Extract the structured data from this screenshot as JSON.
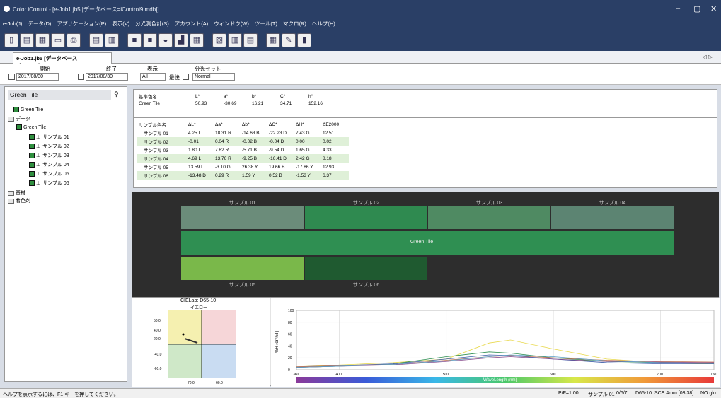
{
  "window": {
    "title": "Color iControl - [e-Job1.jb5 [データベース=iControl9.mdb]]",
    "controls": [
      "–",
      "▢",
      "✕"
    ]
  },
  "menu": [
    "e-Job(J)",
    "データ(D)",
    "アプリケーション(P)",
    "表示(V)",
    "分光測色計(S)",
    "アカウント(A)",
    "ウィンドウ(W)",
    "ツール(T)",
    "マクロ(R)",
    "ヘルプ(H)"
  ],
  "toolbar_icons": [
    "new-doc-icon",
    "open-doc-icon",
    "copy-doc-icon",
    "print-preview-icon",
    "print-icon",
    "report-icon",
    "list-icon",
    "measure-icon",
    "measure2-icon",
    "calibrate-icon",
    "average-icon",
    "doc-a-icon",
    "doc-b-icon",
    "doc-c-icon",
    "doc-d-icon",
    "grid-icon",
    "tool-icon",
    "chart-icon"
  ],
  "tab": {
    "label": "e-Job1.jb5 [データベース=iControl9....",
    "nav": "◁ ▷"
  },
  "filter": {
    "start_label": "開始",
    "end_label": "終了",
    "start_date": "2017/08/30",
    "end_date": "2017/08/30",
    "show_label": "表示",
    "show_value": "All",
    "latest_label": "最後",
    "preset_label": "分光セット",
    "preset_value": "Normal"
  },
  "tree": {
    "header": "Green Tile",
    "root": "Green Tile",
    "data": "データ",
    "group": "Green Tile",
    "samples": [
      "サンプル 01",
      "サンプル 02",
      "サンプル 03",
      "サンプル 04",
      "サンプル 05",
      "サンプル 06"
    ],
    "substrate": "基材",
    "colorant": "着色剤"
  },
  "reference": {
    "headers": [
      "基準色名",
      "L*",
      "a*",
      "b*",
      "C*",
      "h°"
    ],
    "row": [
      "Green Tile",
      "50.93",
      "-30.69",
      "16.21",
      "34.71",
      "152.16"
    ]
  },
  "difference": {
    "headers": [
      "サンプル色名",
      "ΔL*",
      "Δa*",
      "Δb*",
      "ΔC*",
      "ΔH*",
      "ΔE2000"
    ],
    "rows": [
      [
        "サンプル 01",
        "4.25 L",
        "18.31 R",
        "-14.63 B",
        "-22.23 D",
        "7.43 G",
        "12.51"
      ],
      [
        "サンプル 02",
        "-0.01",
        "0.04 R",
        "-0.02 B",
        "-0.04 D",
        "0.00",
        "0.02"
      ],
      [
        "サンプル 03",
        "1.80 L",
        "7.82 R",
        "-5.71 B",
        "-9.54 D",
        "1.65 G",
        "4.33"
      ],
      [
        "サンプル 04",
        "4.69 L",
        "13.76 R",
        "-9.25 B",
        "-16.41 D",
        "2.42 G",
        "8.18"
      ],
      [
        "サンプル 05",
        "13.59 L",
        "-3.10 G",
        "26.38 Y",
        "19.66 B",
        "-17.86 Y",
        "12.93"
      ],
      [
        "サンプル 06",
        "-13.48 D",
        "0.29 R",
        "1.59 Y",
        "0.52 B",
        "-1.53 Y",
        "6.37"
      ]
    ]
  },
  "swatches": {
    "labels": [
      "サンプル 01",
      "サンプル 02",
      "サンプル 03",
      "サンプル 04",
      "Green Tile",
      "サンプル 05",
      "サンプル 06"
    ],
    "colors": [
      "#6b8c7a",
      "#2f8a50",
      "#4f8a62",
      "#5c8472",
      "#2f8f52",
      "#7ab84a",
      "#1f5a30"
    ]
  },
  "cie": {
    "title": "CIELab: D65-10",
    "top": "イエロー",
    "left_ticks": [
      "50.0",
      "40.0",
      "20.0",
      "-40.0",
      "-60.0"
    ],
    "bottom": "70.0",
    "bottom2": "60.0",
    "quadrant_colors": [
      "#f5f0b0",
      "#f6d6d8",
      "#cfe8c8",
      "#c9dcf2"
    ]
  },
  "chart_data": {
    "type": "line",
    "xlabel": "WaveLength (nm)",
    "ylabel": "%R (or %T)",
    "x_ticks": [
      360,
      400,
      500,
      600,
      700,
      750
    ],
    "y_ticks": [
      0,
      20,
      40,
      60,
      80,
      100
    ],
    "xlim": [
      360,
      750
    ],
    "ylim": [
      0,
      100
    ],
    "x": [
      360,
      400,
      450,
      500,
      540,
      560,
      600,
      650,
      700,
      750
    ],
    "series": [
      {
        "color": "#e8d84a",
        "values": [
          5,
          8,
          12,
          18,
          45,
          50,
          35,
          18,
          12,
          10
        ]
      },
      {
        "color": "#2f8f52",
        "values": [
          4,
          6,
          10,
          22,
          30,
          28,
          20,
          14,
          12,
          11
        ]
      },
      {
        "color": "#3a5ba8",
        "values": [
          5,
          7,
          10,
          18,
          25,
          24,
          18,
          12,
          10,
          10
        ]
      },
      {
        "color": "#8a5090",
        "values": [
          4,
          6,
          8,
          14,
          20,
          22,
          18,
          14,
          13,
          12
        ]
      },
      {
        "color": "#c87a5a",
        "values": [
          5,
          7,
          9,
          16,
          22,
          24,
          20,
          16,
          14,
          13
        ]
      },
      {
        "color": "#5aa0c8",
        "values": [
          4,
          6,
          9,
          15,
          22,
          25,
          22,
          15,
          12,
          11
        ]
      }
    ]
  },
  "status": {
    "help": "ヘルプを表示するには、F1 キーを押してください。",
    "pf": "P/F=1.00",
    "sample": "サンプル 01",
    "count": "0/6/7",
    "illum": "D65-10",
    "mode": "SCE 4mm [03:38]",
    "gloss": "NO glo"
  }
}
